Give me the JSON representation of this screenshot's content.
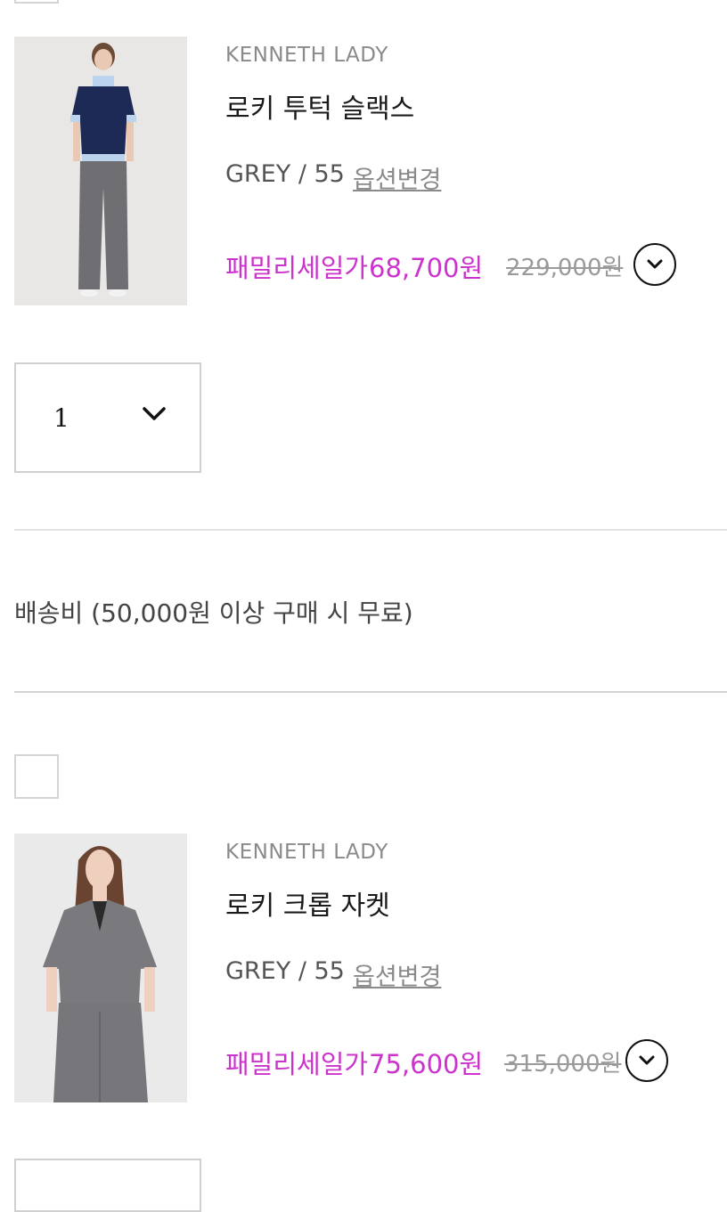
{
  "products": [
    {
      "brand": "KENNETH LADY",
      "name": "로키 투턱 슬랙스",
      "option": "GREY / 55",
      "option_change": "옵션변경",
      "sale_label": "패밀리세일가",
      "sale_price": "68,700원",
      "original_price": "229,000원",
      "quantity": "1",
      "top_colors": {
        "knit": "#1c2a55",
        "pants": "#6f6f73"
      }
    },
    {
      "brand": "KENNETH LADY",
      "name": "로키 크롭 자켓",
      "option": "GREY / 55",
      "option_change": "옵션변경",
      "sale_label": "패밀리세일가",
      "sale_price": "75,600원",
      "original_price": "315,000원",
      "top_colors": {
        "jacket": "#7a7a7e",
        "pants": "#77777b"
      }
    }
  ],
  "shipping": {
    "label": "배송비 (50,000원 이상 구매 시 무료)"
  },
  "colors": {
    "sale": "#cc33cc",
    "divider": "#e3e3e3",
    "checkbox_border": "#d4d4d4"
  },
  "icons": {
    "expand": "chevron-down-icon"
  }
}
